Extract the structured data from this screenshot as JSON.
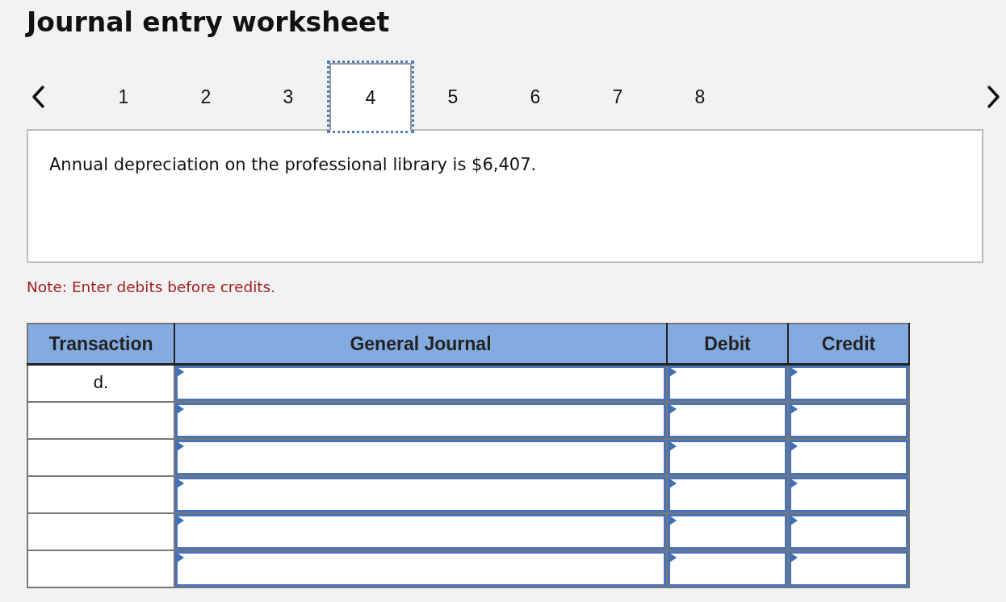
{
  "title": "Journal entry worksheet",
  "tabs": [
    {
      "label": "1",
      "selected": false
    },
    {
      "label": "2",
      "selected": false
    },
    {
      "label": "3",
      "selected": false
    },
    {
      "label": "4",
      "selected": true
    },
    {
      "label": "5",
      "selected": false
    },
    {
      "label": "6",
      "selected": false
    },
    {
      "label": "7",
      "selected": false
    },
    {
      "label": "8",
      "selected": false
    }
  ],
  "prompt": "Annual depreciation on the professional library is $6,407.",
  "note": "Note: Enter debits before credits.",
  "table": {
    "columns": [
      "Transaction",
      "General Journal",
      "Debit",
      "Credit"
    ],
    "rows": [
      {
        "transaction": "d."
      },
      {},
      {},
      {},
      {},
      {}
    ]
  }
}
